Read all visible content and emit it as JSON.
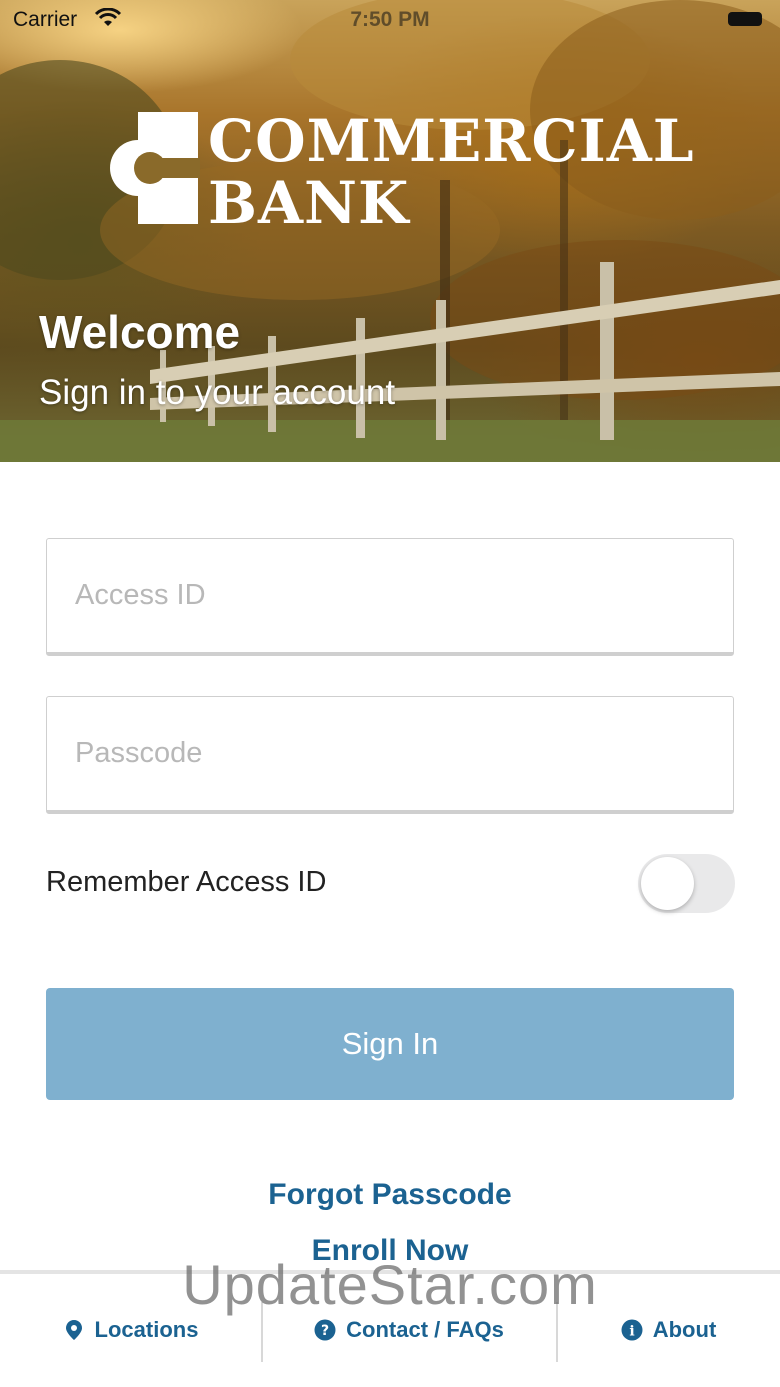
{
  "status_bar": {
    "carrier": "Carrier",
    "time": "7:50 PM"
  },
  "hero": {
    "logo_line1": "COMMERCIAL",
    "logo_line2": "BANK",
    "title": "Welcome",
    "subtitle": "Sign in to your account"
  },
  "form": {
    "access_id_placeholder": "Access ID",
    "access_id_value": "",
    "passcode_placeholder": "Passcode",
    "passcode_value": "",
    "remember_label": "Remember Access ID",
    "remember_enabled": false,
    "sign_in_label": "Sign In"
  },
  "links": {
    "forgot": "Forgot Passcode",
    "enroll": "Enroll Now"
  },
  "tabbar": {
    "locations": "Locations",
    "contact": "Contact / FAQs",
    "about": "About"
  },
  "watermark": "UpdateStar.com",
  "colors": {
    "accent": "#1b6291",
    "button": "#7fb0cf",
    "toggle_off": "#e9e9ea"
  },
  "icons": {
    "locations": "map-pin-icon",
    "contact": "question-circle-icon",
    "about": "info-circle-icon"
  }
}
